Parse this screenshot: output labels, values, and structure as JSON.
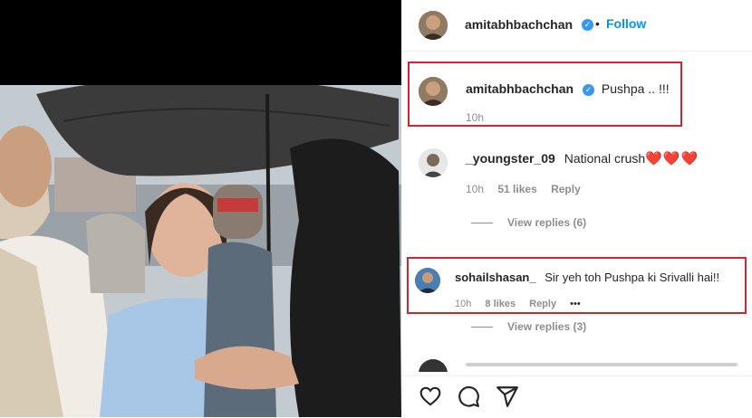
{
  "post": {
    "author": "amitabhbachchan",
    "follow_label": "Follow",
    "separator": "•",
    "verified_glyph": "✓"
  },
  "caption": {
    "author": "amitabhbachchan",
    "text": "Pushpa .. !!!",
    "time": "10h"
  },
  "comments": [
    {
      "author": "_youngster_09",
      "text": "National crush",
      "emoji": "❤️❤️❤️",
      "time": "10h",
      "likes": "51 likes",
      "reply_label": "Reply",
      "view_replies": "View replies (6)"
    },
    {
      "author": "sohailshasan_",
      "text": "Sir yeh toh Pushpa ki Srivalli hai!!",
      "time": "10h",
      "likes": "8 likes",
      "reply_label": "Reply",
      "more": "•••",
      "view_replies": "View replies (3)"
    }
  ],
  "actions": [
    "heart-icon",
    "comment-icon",
    "share-icon"
  ],
  "colors": {
    "accent": "#0095f6",
    "highlight_box": "#d1262f",
    "verified": "#3897f0"
  }
}
